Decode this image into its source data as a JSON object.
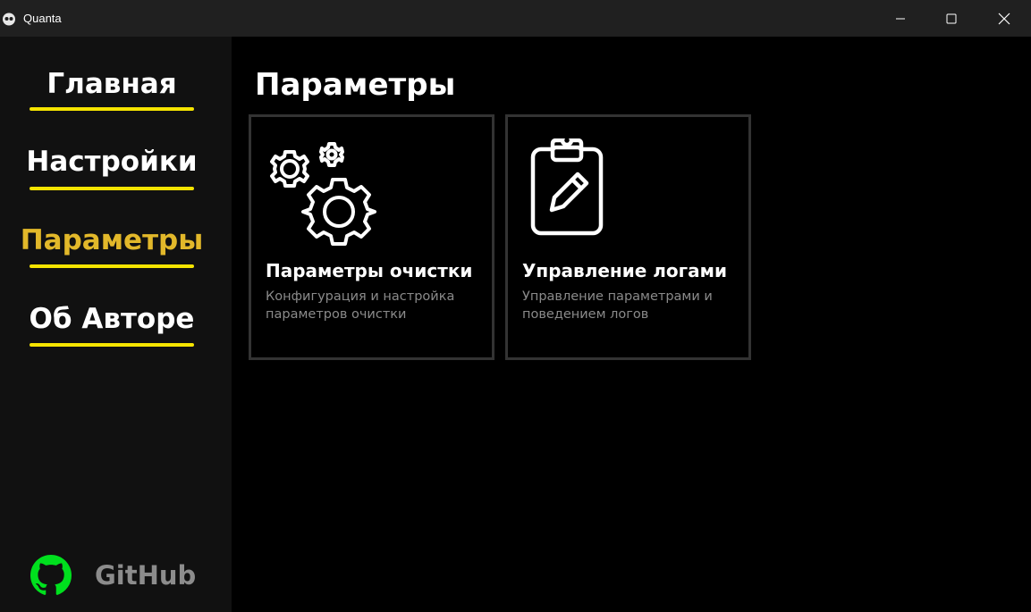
{
  "window": {
    "title": "Quanta"
  },
  "sidebar": {
    "items": [
      {
        "label": "Главная",
        "active": false
      },
      {
        "label": "Настройки",
        "active": false
      },
      {
        "label": "Параметры",
        "active": true
      },
      {
        "label": "Об Авторе",
        "active": false
      }
    ],
    "github_label": "GitHub",
    "colors": {
      "underline": "#f5e400",
      "active_text": "#e2b82a",
      "github_icon": "#00e01e"
    }
  },
  "main": {
    "title": "Параметры",
    "cards": [
      {
        "icon": "gears-icon",
        "title": "Параметры очистки",
        "description": "Конфигурация и настройка параметров очистки"
      },
      {
        "icon": "clipboard-edit-icon",
        "title": "Управление логами",
        "description": "Управление параметрами и поведением логов"
      }
    ]
  }
}
